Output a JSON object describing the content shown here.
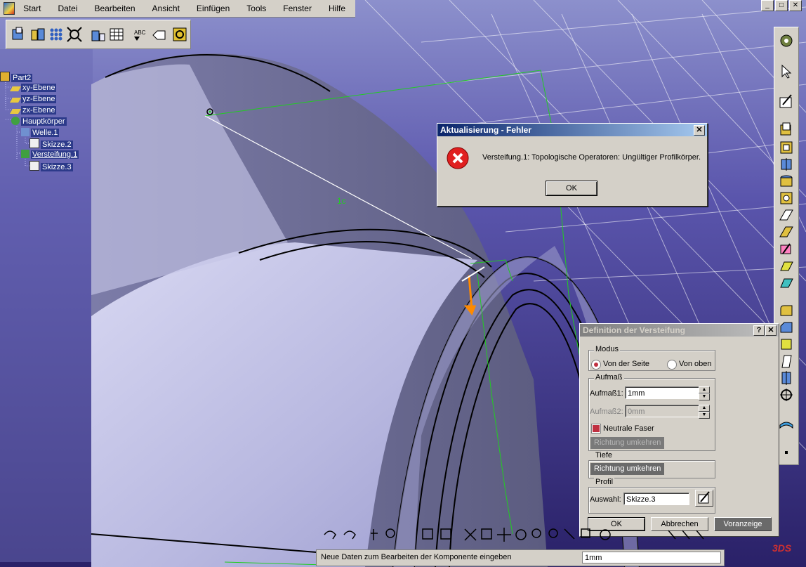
{
  "menu": {
    "items": [
      "Start",
      "Datei",
      "Bearbeiten",
      "Ansicht",
      "Einfügen",
      "Tools",
      "Fenster",
      "Hilfe"
    ]
  },
  "window_controls": [
    "_",
    "□",
    "✕"
  ],
  "tree": {
    "nodes": [
      {
        "label": "Part2",
        "icon": "part-icon"
      },
      {
        "label": "xy-Ebene",
        "icon": "plane-icon"
      },
      {
        "label": "yz-Ebene",
        "icon": "plane-icon"
      },
      {
        "label": "zx-Ebene",
        "icon": "plane-icon"
      },
      {
        "label": "Hauptkörper",
        "icon": "body-icon"
      },
      {
        "label": "Welle.1",
        "icon": "shaft-icon"
      },
      {
        "label": "Skizze.2",
        "icon": "sketch-icon"
      },
      {
        "label": "Versteifung.1",
        "icon": "stiffener-icon"
      },
      {
        "label": "Skizze.3",
        "icon": "sketch-icon"
      }
    ]
  },
  "error_dialog": {
    "title": "Aktualisierung - Fehler",
    "message": "Versteifung.1: Topologische Operatoren: Ungültiger Profilkörper.",
    "ok_label": "OK",
    "close_label": "✕",
    "icon": "error-icon"
  },
  "stiffener_dialog": {
    "title": "Definition der Versteifung",
    "help_label": "?",
    "close_label": "✕",
    "modus": {
      "title": "Modus",
      "option_side": "Von der Seite",
      "option_top": "Von oben",
      "selected": "Von der Seite"
    },
    "aufmass": {
      "title": "Aufmaß",
      "label1": "Aufmaß1:",
      "value1": "1mm",
      "label2": "Aufmaß2:",
      "value2": "0mm",
      "neutral_label": "Neutrale Faser",
      "neutral_checked": true,
      "reverse_label": "Richtung umkehren"
    },
    "tiefe": {
      "title": "Tiefe",
      "reverse_label": "Richtung umkehren"
    },
    "profil": {
      "title": "Profil",
      "label": "Auswahl:",
      "value": "Skizze.3"
    },
    "ok_label": "OK",
    "cancel_label": "Abbrechen",
    "preview_label": "Voranzeige"
  },
  "status_bar": {
    "text": "Neue Daten zum Bearbeiten der Komponente eingeben",
    "input_value": "1mm"
  },
  "viewport": {
    "dimension_label": "1c",
    "colors": {
      "accent": "#3a2f8d",
      "part": "#c8c8e8",
      "construction": "#22cc22"
    }
  }
}
